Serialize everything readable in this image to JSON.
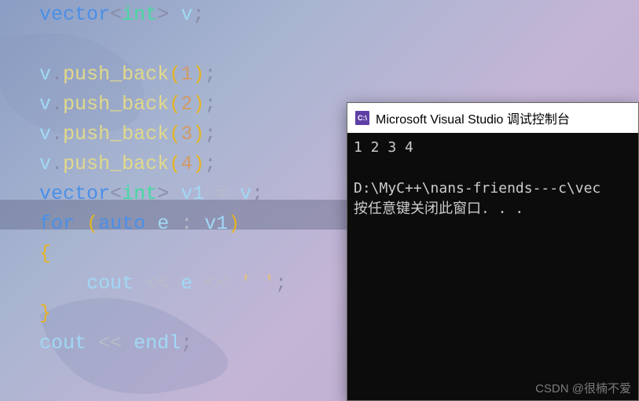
{
  "code": {
    "line1": {
      "kw1": "vector",
      "punct1": "<",
      "type1": "int",
      "punct2": ">",
      "sp": " ",
      "var1": "v",
      "punct3": ";"
    },
    "line3": {
      "var": "v",
      "dot": ".",
      "func": "push_back",
      "open": "(",
      "num": "1",
      "close": ")",
      "semi": ";"
    },
    "line4": {
      "var": "v",
      "dot": ".",
      "func": "push_back",
      "open": "(",
      "num": "2",
      "close": ")",
      "semi": ";"
    },
    "line5": {
      "var": "v",
      "dot": ".",
      "func": "push_back",
      "open": "(",
      "num": "3",
      "close": ")",
      "semi": ";"
    },
    "line6": {
      "var": "v",
      "dot": ".",
      "func": "push_back",
      "open": "(",
      "num": "4",
      "close": ")",
      "semi": ";"
    },
    "line7": {
      "kw1": "vector",
      "punct1": "<",
      "type1": "int",
      "punct2": ">",
      "sp": " ",
      "var1": "v1",
      "eq": " = ",
      "var2": "v",
      "semi": ";"
    },
    "line8": {
      "kw1": "for",
      "open": " (",
      "kw2": "auto",
      "sp1": " ",
      "var1": "e",
      "sp2": " : ",
      "var2": "v1",
      "close": ")"
    },
    "line9": {
      "brace": "{"
    },
    "line10": {
      "indent": "    ",
      "var1": "cout",
      "op1": " << ",
      "var2": "e",
      "op2": " << ",
      "char": "' '",
      "semi": ";"
    },
    "line11": {
      "brace": "}"
    },
    "line12": {
      "var1": "cout",
      "op1": " << ",
      "var2": "endl",
      "semi": ";"
    }
  },
  "console": {
    "title": "Microsoft Visual Studio 调试控制台",
    "icon_text": "C:\\",
    "output_line1": "1 2 3 4",
    "output_line3": "D:\\MyC++\\nans-friends---c\\vec",
    "output_line4": "按任意键关闭此窗口. . ."
  },
  "watermark": "CSDN @很楠不爱"
}
